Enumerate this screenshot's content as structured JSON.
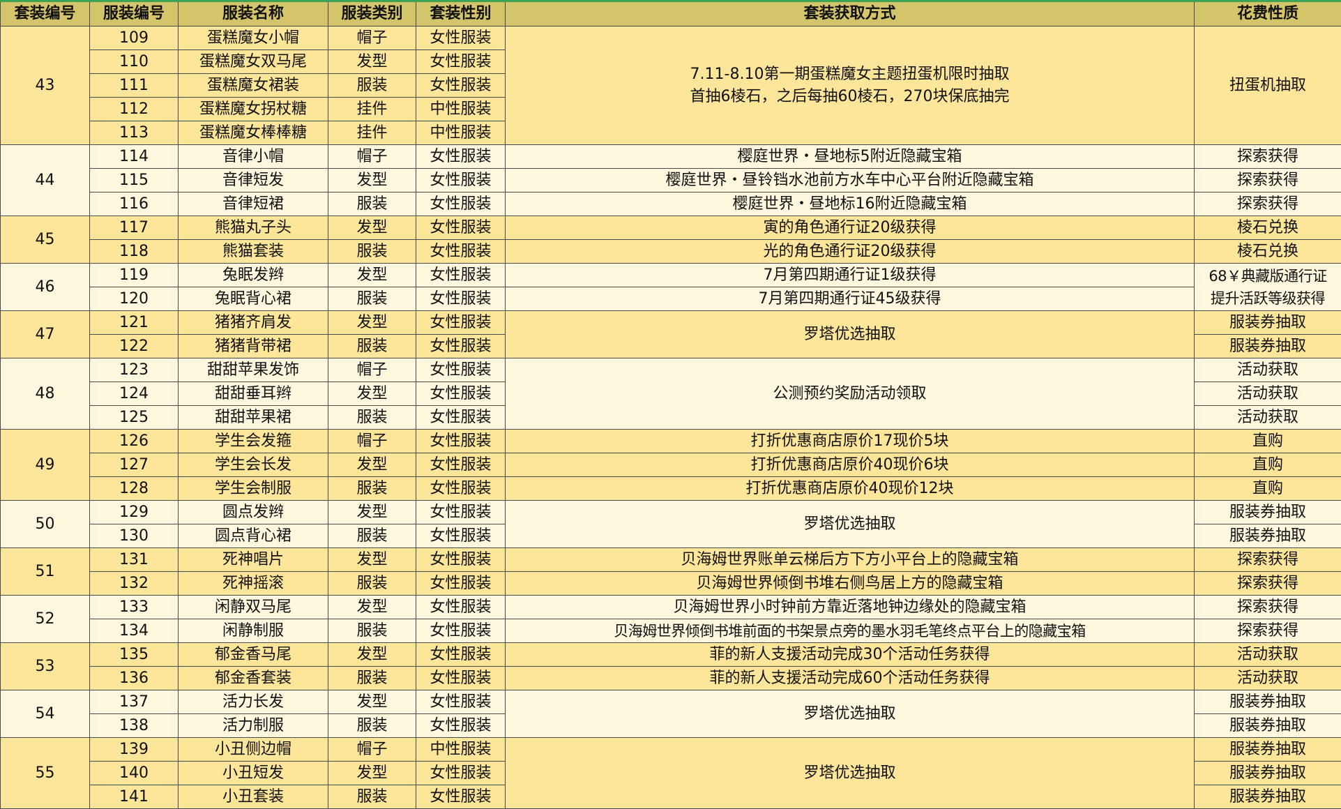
{
  "columns": [
    "套装编号",
    "服装编号",
    "服装名称",
    "服装类别",
    "套装性别",
    "套装获取方式",
    "花费性质"
  ],
  "suits": [
    {
      "id": "43",
      "items": [
        {
          "no": "109",
          "name": "蛋糕魔女小帽",
          "cat": "帽子",
          "gender": "女性服装",
          "method": "7.11-8.10第一期蛋糕魔女主题扭蛋机限时抽取\n首抽6棱石，之后每抽60棱石，270块保底抽完",
          "cost": "扭蛋机抽取"
        },
        {
          "no": "110",
          "name": "蛋糕魔女双马尾",
          "cat": "发型",
          "gender": "女性服装"
        },
        {
          "no": "111",
          "name": "蛋糕魔女裙装",
          "cat": "服装",
          "gender": "女性服装"
        },
        {
          "no": "112",
          "name": "蛋糕魔女拐杖糖",
          "cat": "挂件",
          "gender": "中性服装"
        },
        {
          "no": "113",
          "name": "蛋糕魔女棒棒糖",
          "cat": "挂件",
          "gender": "中性服装"
        }
      ]
    },
    {
      "id": "44",
      "items": [
        {
          "no": "114",
          "name": "音律小帽",
          "cat": "帽子",
          "gender": "女性服装",
          "method": "樱庭世界・昼地标5附近隐藏宝箱",
          "cost": "探索获得"
        },
        {
          "no": "115",
          "name": "音律短发",
          "cat": "发型",
          "gender": "女性服装",
          "method": "樱庭世界・昼铃铛水池前方水车中心平台附近隐藏宝箱",
          "cost": "探索获得"
        },
        {
          "no": "116",
          "name": "音律短裙",
          "cat": "服装",
          "gender": "女性服装",
          "method": "樱庭世界・昼地标16附近隐藏宝箱",
          "cost": "探索获得"
        }
      ]
    },
    {
      "id": "45",
      "items": [
        {
          "no": "117",
          "name": "熊猫丸子头",
          "cat": "发型",
          "gender": "女性服装",
          "method": "寅的角色通行证20级获得",
          "cost": "棱石兑换"
        },
        {
          "no": "118",
          "name": "熊猫套装",
          "cat": "服装",
          "gender": "女性服装",
          "method": "光的角色通行证20级获得",
          "cost": "棱石兑换"
        }
      ]
    },
    {
      "id": "46",
      "items": [
        {
          "no": "119",
          "name": "兔眠发辫",
          "cat": "发型",
          "gender": "女性服装",
          "method": "7月第四期通行证1级获得",
          "cost": "68￥典藏版通行证\n提升活跃等级获得"
        },
        {
          "no": "120",
          "name": "兔眠背心裙",
          "cat": "服装",
          "gender": "女性服装",
          "method": "7月第四期通行证45级获得"
        }
      ]
    },
    {
      "id": "47",
      "items": [
        {
          "no": "121",
          "name": "猪猪齐肩发",
          "cat": "发型",
          "gender": "女性服装",
          "method": "罗塔优选抽取",
          "cost": "服装券抽取"
        },
        {
          "no": "122",
          "name": "猪猪背带裙",
          "cat": "服装",
          "gender": "女性服装",
          "cost": "服装券抽取"
        }
      ]
    },
    {
      "id": "48",
      "items": [
        {
          "no": "123",
          "name": "甜甜苹果发饰",
          "cat": "帽子",
          "gender": "女性服装",
          "method": "公测预约奖励活动领取",
          "cost": "活动获取"
        },
        {
          "no": "124",
          "name": "甜甜垂耳辫",
          "cat": "发型",
          "gender": "女性服装",
          "cost": "活动获取"
        },
        {
          "no": "125",
          "name": "甜甜苹果裙",
          "cat": "服装",
          "gender": "女性服装",
          "cost": "活动获取"
        }
      ]
    },
    {
      "id": "49",
      "items": [
        {
          "no": "126",
          "name": "学生会发箍",
          "cat": "帽子",
          "gender": "女性服装",
          "method": "打折优惠商店原价17现价5块",
          "cost": "直购"
        },
        {
          "no": "127",
          "name": "学生会长发",
          "cat": "发型",
          "gender": "女性服装",
          "method": "打折优惠商店原价40现价6块",
          "cost": "直购"
        },
        {
          "no": "128",
          "name": "学生会制服",
          "cat": "服装",
          "gender": "女性服装",
          "method": "打折优惠商店原价40现价12块",
          "cost": "直购"
        }
      ]
    },
    {
      "id": "50",
      "items": [
        {
          "no": "129",
          "name": "圆点发辫",
          "cat": "发型",
          "gender": "女性服装",
          "method": "罗塔优选抽取",
          "cost": "服装券抽取"
        },
        {
          "no": "130",
          "name": "圆点背心裙",
          "cat": "服装",
          "gender": "女性服装",
          "cost": "服装券抽取"
        }
      ]
    },
    {
      "id": "51",
      "items": [
        {
          "no": "131",
          "name": "死神唱片",
          "cat": "发型",
          "gender": "女性服装",
          "method": "贝海姆世界账单云梯后方下方小平台上的隐藏宝箱",
          "cost": "探索获得"
        },
        {
          "no": "132",
          "name": "死神摇滚",
          "cat": "服装",
          "gender": "女性服装",
          "method": "贝海姆世界倾倒书堆右侧鸟居上方的隐藏宝箱",
          "cost": "探索获得"
        }
      ]
    },
    {
      "id": "52",
      "items": [
        {
          "no": "133",
          "name": "闲静双马尾",
          "cat": "发型",
          "gender": "女性服装",
          "method": "贝海姆世界小时钟前方靠近落地钟边缘处的隐藏宝箱",
          "cost": "探索获得"
        },
        {
          "no": "134",
          "name": "闲静制服",
          "cat": "服装",
          "gender": "女性服装",
          "method": "贝海姆世界倾倒书堆前面的书架景点旁的墨水羽毛笔终点平台上的隐藏宝箱",
          "cost": "探索获得"
        }
      ]
    },
    {
      "id": "53",
      "items": [
        {
          "no": "135",
          "name": "郁金香马尾",
          "cat": "发型",
          "gender": "女性服装",
          "method": "菲的新人支援活动完成30个活动任务获得",
          "cost": "活动获取"
        },
        {
          "no": "136",
          "name": "郁金香套装",
          "cat": "服装",
          "gender": "女性服装",
          "method": "菲的新人支援活动完成60个活动任务获得",
          "cost": "活动获取"
        }
      ]
    },
    {
      "id": "54",
      "items": [
        {
          "no": "137",
          "name": "活力长发",
          "cat": "发型",
          "gender": "女性服装",
          "method": "罗塔优选抽取",
          "cost": "服装券抽取"
        },
        {
          "no": "138",
          "name": "活力制服",
          "cat": "服装",
          "gender": "女性服装",
          "cost": "服装券抽取"
        }
      ]
    },
    {
      "id": "55",
      "items": [
        {
          "no": "139",
          "name": "小丑侧边帽",
          "cat": "帽子",
          "gender": "中性服装",
          "method": "罗塔优选抽取",
          "cost": "服装券抽取"
        },
        {
          "no": "140",
          "name": "小丑短发",
          "cat": "发型",
          "gender": "女性服装",
          "cost": "服装券抽取"
        },
        {
          "no": "141",
          "name": "小丑套装",
          "cat": "服装",
          "gender": "女性服装",
          "cost": "服装券抽取"
        }
      ]
    }
  ]
}
